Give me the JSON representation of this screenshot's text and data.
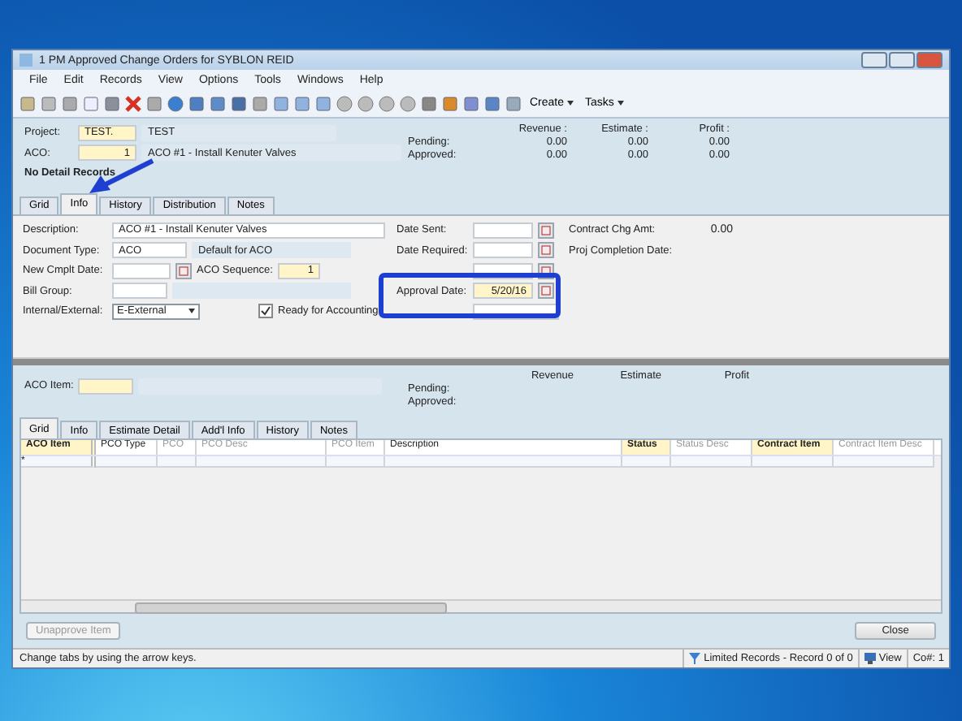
{
  "window": {
    "title": "1 PM Approved Change Orders for SYBLON REID"
  },
  "menu": [
    "File",
    "Edit",
    "Records",
    "View",
    "Options",
    "Tools",
    "Windows",
    "Help"
  ],
  "toolbar": {
    "buttons": [
      "Create",
      "Tasks"
    ]
  },
  "header": {
    "project": {
      "label": "Project:",
      "code": "TEST.",
      "name": "TEST"
    },
    "aco": {
      "label": "ACO:",
      "code": "1",
      "desc": "ACO #1 - Install Kenuter Valves"
    },
    "totals": {
      "columns": [
        "Revenue :",
        "Estimate :",
        "Profit :"
      ],
      "rows": [
        {
          "label": "Pending:",
          "values": [
            "0.00",
            "0.00",
            "0.00"
          ]
        },
        {
          "label": "Approved:",
          "values": [
            "0.00",
            "0.00",
            "0.00"
          ]
        }
      ]
    },
    "note": "No Detail Records"
  },
  "tabs": [
    {
      "label": "Grid",
      "selected": false
    },
    {
      "label": "Info",
      "selected": true
    },
    {
      "label": "History",
      "selected": false
    },
    {
      "label": "Distribution",
      "selected": false
    },
    {
      "label": "Notes",
      "selected": false
    }
  ],
  "info": {
    "description": {
      "label": "Description:",
      "value": "ACO #1 - Install Kenuter Valves"
    },
    "document_type": {
      "label": "Document Type:",
      "value": "ACO",
      "note": "Default for ACO"
    },
    "new_cmplt_date": {
      "label": "New Cmplt Date:"
    },
    "aco_sequence": {
      "label": "ACO Sequence:",
      "value": "1"
    },
    "bill_group": {
      "label": "Bill Group:"
    },
    "internal_external": {
      "label": "Internal/External:",
      "value": "E-External"
    },
    "ready_for_accounting": {
      "label": "Ready for Accounting",
      "checked": true
    },
    "date_sent": {
      "label": "Date Sent:"
    },
    "date_required": {
      "label": "Date Required:"
    },
    "approval_date": {
      "label": "Approval Date:",
      "value": "5/20/16"
    },
    "contract_chg_amt": {
      "label": "Contract Chg Amt:",
      "value": "0.00"
    },
    "proj_completion_date": {
      "label": "Proj Completion Date:"
    }
  },
  "item": {
    "label": "ACO Item:",
    "columns": [
      "Revenue",
      "Estimate",
      "Profit"
    ],
    "rows": [
      "Pending:",
      "Approved:"
    ]
  },
  "item_tabs": [
    {
      "label": "Grid",
      "selected": true
    },
    {
      "label": "Info",
      "selected": false
    },
    {
      "label": "Estimate Detail",
      "selected": false
    },
    {
      "label": "Add'l Info",
      "selected": false
    },
    {
      "label": "History",
      "selected": false
    },
    {
      "label": "Notes",
      "selected": false
    }
  ],
  "grid": {
    "new_row_marker": "*",
    "columns": [
      {
        "label": "ACO Item",
        "kind": "key"
      },
      {
        "label": "PCO Type",
        "kind": "normal"
      },
      {
        "label": "PCO",
        "kind": "dim"
      },
      {
        "label": "PCO Desc",
        "kind": "dim"
      },
      {
        "label": "PCO Item",
        "kind": "dim"
      },
      {
        "label": "Description",
        "kind": "normal"
      },
      {
        "label": "Status",
        "kind": "key"
      },
      {
        "label": "Status Desc",
        "kind": "dim"
      },
      {
        "label": "Contract Item",
        "kind": "key"
      },
      {
        "label": "Contract Item Desc",
        "kind": "dim"
      }
    ]
  },
  "buttons": [
    {
      "label": "Unapprove Item",
      "disabled": true
    },
    {
      "label": "Close",
      "disabled": false
    }
  ],
  "status_bar": {
    "message": "Change tabs by using the arrow keys.",
    "records": "Limited Records - Record 0 of 0",
    "view": "View",
    "company": "Co#: 1"
  }
}
